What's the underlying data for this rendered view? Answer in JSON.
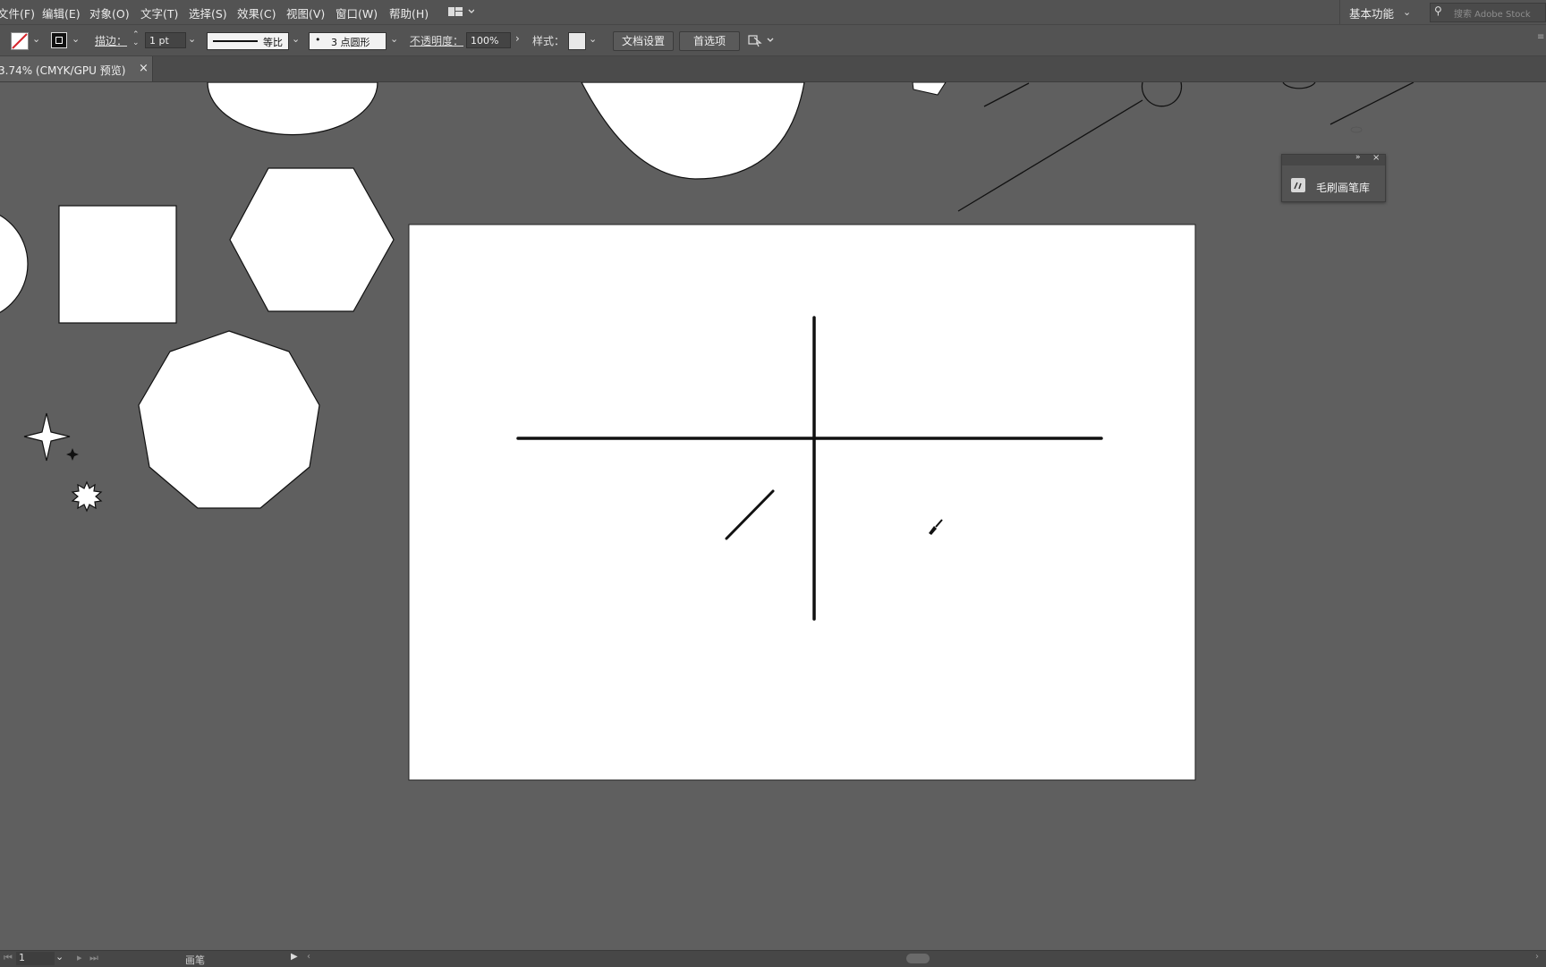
{
  "menu": [
    "文件(F)",
    "编辑(E)",
    "对象(O)",
    "文字(T)",
    "选择(S)",
    "效果(C)",
    "视图(V)",
    "窗口(W)",
    "帮助(H)"
  ],
  "workspace": "基本功能",
  "search_placeholder": "搜索 Adobe Stock",
  "toolbar": {
    "stroke_label": "描边：",
    "stroke_value": "1 pt",
    "profile_label": "等比",
    "brush_label": "3 点圆形",
    "opacity_label": "不透明度：",
    "opacity_value": "100%",
    "style_label": "样式：",
    "doc_setup": "文档设置",
    "preferences": "首选项"
  },
  "tab": {
    "title": "3.74% (CMYK/GPU 预览)",
    "close": "×"
  },
  "panel": {
    "title": "毛刷画笔库"
  },
  "status": {
    "artboard": "1",
    "tool": "画笔"
  },
  "colors": {
    "chrome": "#535353",
    "canvas": "#5f5f5f",
    "artboard": "#ffffff",
    "stroke_swatch": "#d6262c"
  }
}
